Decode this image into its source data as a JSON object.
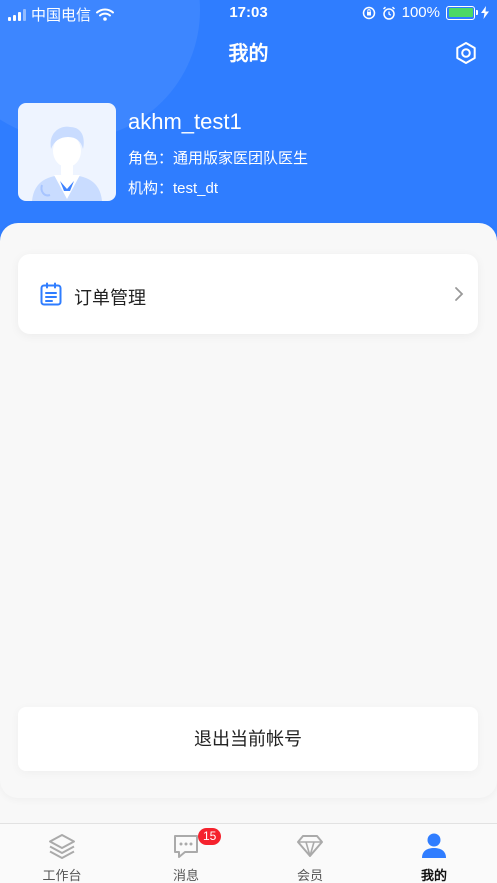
{
  "status_bar": {
    "carrier": "中国电信",
    "time": "17:03",
    "battery": "100%"
  },
  "header": {
    "title": "我的"
  },
  "profile": {
    "name": "akhm_test1",
    "role": "角色：通用版家医团队医生",
    "org": "机构：test_dt"
  },
  "menu": {
    "order_management": "订单管理"
  },
  "logout": {
    "label": "退出当前帐号"
  },
  "tabbar": {
    "tabs": [
      {
        "label": "工作台",
        "icon": "layers-icon"
      },
      {
        "label": "消息",
        "icon": "chat-icon",
        "badge": "15"
      },
      {
        "label": "会员",
        "icon": "diamond-icon"
      },
      {
        "label": "我的",
        "icon": "person-icon"
      }
    ],
    "active_index": 3
  },
  "colors": {
    "primary": "#2f7dff",
    "badge": "#f5222d",
    "battery": "#4cd964"
  }
}
